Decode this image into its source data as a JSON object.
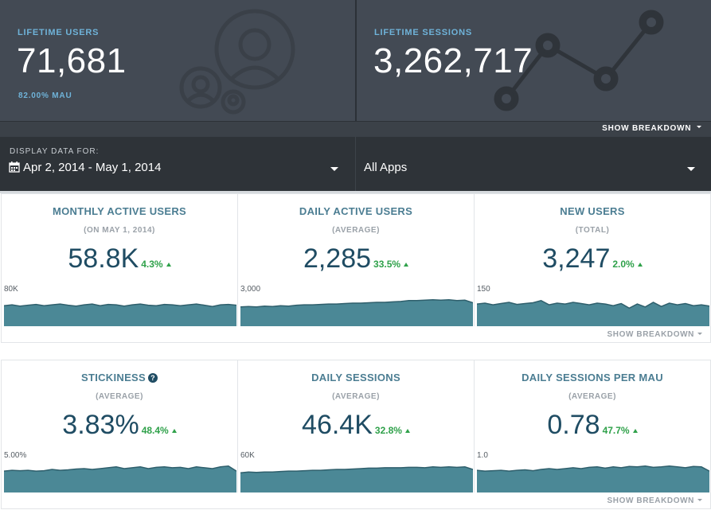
{
  "hero": {
    "lifetime_users": {
      "label": "LIFETIME USERS",
      "value": "71,681",
      "sub": "82.00% MAU"
    },
    "lifetime_sessions": {
      "label": "LIFETIME SESSIONS",
      "value": "3,262,717"
    },
    "show_breakdown": "SHOW BREAKDOWN"
  },
  "filter": {
    "label": "DISPLAY DATA FOR:",
    "date_range": "Apr 2, 2014 - May 1, 2014",
    "app": "All Apps"
  },
  "sections": [
    {
      "breakdown": "SHOW BREAKDOWN",
      "cards": [
        {
          "title": "MONTHLY ACTIVE USERS",
          "sub": "(ON MAY 1, 2014)",
          "value": "58.8K",
          "delta": "4.3%",
          "spark_label": "80K",
          "spark": [
            0.58,
            0.6,
            0.57,
            0.59,
            0.61,
            0.58,
            0.6,
            0.62,
            0.59,
            0.57,
            0.6,
            0.62,
            0.58,
            0.61,
            0.6,
            0.57,
            0.6,
            0.62,
            0.59,
            0.58,
            0.61,
            0.6,
            0.58,
            0.6,
            0.62,
            0.59,
            0.56,
            0.6,
            0.61,
            0.59
          ]
        },
        {
          "title": "DAILY ACTIVE USERS",
          "sub": "(AVERAGE)",
          "value": "2,285",
          "delta": "33.5%",
          "spark_label": "3,000",
          "spark": [
            0.55,
            0.56,
            0.55,
            0.57,
            0.56,
            0.58,
            0.57,
            0.59,
            0.6,
            0.6,
            0.61,
            0.62,
            0.62,
            0.63,
            0.64,
            0.64,
            0.65,
            0.66,
            0.66,
            0.67,
            0.68,
            0.7,
            0.7,
            0.71,
            0.72,
            0.71,
            0.72,
            0.7,
            0.71,
            0.65
          ]
        },
        {
          "title": "NEW USERS",
          "sub": "(TOTAL)",
          "value": "3,247",
          "delta": "2.0%",
          "spark_label": "150",
          "spark": [
            0.62,
            0.64,
            0.6,
            0.63,
            0.66,
            0.61,
            0.63,
            0.65,
            0.7,
            0.6,
            0.64,
            0.62,
            0.66,
            0.63,
            0.6,
            0.64,
            0.62,
            0.58,
            0.63,
            0.52,
            0.62,
            0.55,
            0.66,
            0.56,
            0.64,
            0.6,
            0.63,
            0.58,
            0.6,
            0.57
          ]
        }
      ]
    },
    {
      "breakdown": "SHOW BREAKDOWN",
      "cards": [
        {
          "title": "STICKINESS",
          "sub": "(AVERAGE)",
          "value": "3.83%",
          "delta": "48.4%",
          "spark_label": "5.00%",
          "has_help": true,
          "spark": [
            0.6,
            0.62,
            0.61,
            0.62,
            0.6,
            0.61,
            0.64,
            0.62,
            0.63,
            0.65,
            0.66,
            0.64,
            0.66,
            0.68,
            0.7,
            0.66,
            0.68,
            0.7,
            0.66,
            0.69,
            0.7,
            0.68,
            0.69,
            0.66,
            0.7,
            0.68,
            0.66,
            0.7,
            0.72,
            0.6
          ]
        },
        {
          "title": "DAILY SESSIONS",
          "sub": "(AVERAGE)",
          "value": "46.4K",
          "delta": "32.8%",
          "spark_label": "60K",
          "spark": [
            0.56,
            0.58,
            0.57,
            0.58,
            0.58,
            0.59,
            0.6,
            0.6,
            0.61,
            0.62,
            0.62,
            0.63,
            0.64,
            0.64,
            0.65,
            0.66,
            0.67,
            0.67,
            0.68,
            0.68,
            0.68,
            0.69,
            0.69,
            0.68,
            0.7,
            0.69,
            0.7,
            0.69,
            0.7,
            0.64
          ]
        },
        {
          "title": "DAILY SESSIONS PER MAU",
          "sub": "(AVERAGE)",
          "value": "0.78",
          "delta": "47.7%",
          "spark_label": "1.0",
          "spark": [
            0.62,
            0.6,
            0.61,
            0.62,
            0.6,
            0.62,
            0.63,
            0.61,
            0.64,
            0.66,
            0.64,
            0.66,
            0.68,
            0.66,
            0.69,
            0.7,
            0.67,
            0.7,
            0.68,
            0.71,
            0.7,
            0.72,
            0.69,
            0.7,
            0.72,
            0.7,
            0.68,
            0.71,
            0.7,
            0.6
          ]
        }
      ]
    }
  ],
  "colors": {
    "hero_bg": "#434a54",
    "filter_bg": "#2e3338",
    "accent_blue": "#6fb3d9",
    "title_teal": "#4b7d92",
    "value_navy": "#1f4c63",
    "delta_green": "#2fa14a",
    "spark_fill": "#4b8896",
    "spark_line": "#2f5f6c"
  },
  "icons": {
    "users": "users-icon",
    "sessions": "sessions-graph-icon",
    "calendar": "calendar-icon",
    "help": "help-icon"
  }
}
